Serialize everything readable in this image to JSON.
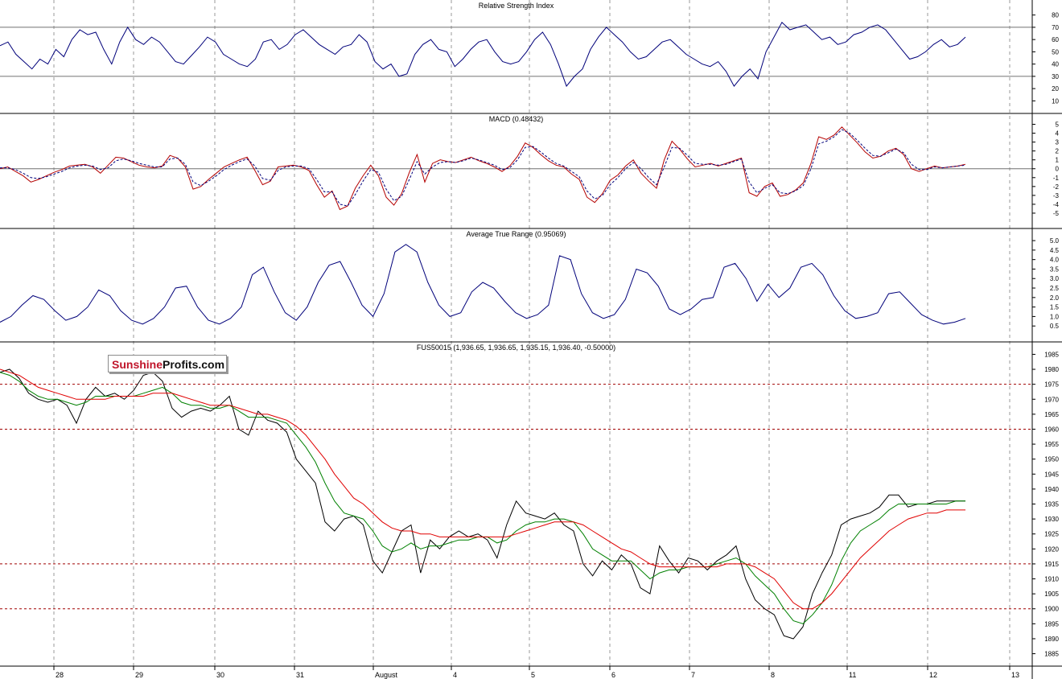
{
  "logo": {
    "part_a": "Sunshine",
    "part_b": "Profits.com"
  },
  "colors": {
    "background": "#ffffff",
    "grid": "#9a9a9a",
    "frame": "#000000",
    "rsi_line": "#00007a",
    "macd_line": "#b40000",
    "macd_signal": "#00007a",
    "atr_line": "#00007a",
    "price_line": "#000000",
    "ma_fast": "#008000",
    "ma_slow": "#e00000",
    "level_line": "#a00000"
  },
  "x_axis": {
    "labels": [
      "28",
      "29",
      "30",
      "31",
      "August",
      "4",
      "5",
      "6",
      "7",
      "8",
      "11",
      "12",
      "13"
    ]
  },
  "chart_data": [
    {
      "type": "line",
      "title": "Relative Strength Index",
      "ylim": [
        5,
        87
      ],
      "yticks": [
        "80",
        "70",
        "60",
        "50",
        "40",
        "30",
        "20",
        "10"
      ],
      "reference_lines": [
        70,
        30
      ],
      "grid": true,
      "series": [
        {
          "values": [
            55,
            58,
            48,
            42,
            36,
            44,
            40,
            52,
            46,
            60,
            68,
            64,
            66,
            52,
            40,
            58,
            70,
            60,
            56,
            62,
            58,
            50,
            42,
            40,
            47,
            54,
            62,
            58,
            48,
            44,
            40,
            38,
            44,
            58,
            60,
            52,
            56,
            64,
            68,
            62,
            56,
            52,
            48,
            54,
            56,
            64,
            58,
            42,
            36,
            40,
            30,
            32,
            48,
            56,
            60,
            52,
            50,
            38,
            44,
            52,
            58,
            60,
            50,
            42,
            40,
            42,
            50,
            60,
            66,
            56,
            40,
            22,
            30,
            36,
            52,
            62,
            70,
            64,
            58,
            50,
            44,
            46,
            52,
            58,
            60,
            54,
            48,
            44,
            40,
            38,
            42,
            34,
            22,
            30,
            36,
            28,
            50,
            62,
            74,
            68,
            70,
            72,
            66,
            60,
            62,
            56,
            58,
            64,
            66,
            70,
            72,
            68,
            60,
            52,
            44,
            46,
            50,
            56,
            60,
            54,
            56,
            62
          ]
        }
      ]
    },
    {
      "type": "line",
      "title": "MACD (0.48432)",
      "ylim": [
        -6,
        5.5
      ],
      "yticks": [
        "5",
        "4",
        "3",
        "2",
        "1",
        "0",
        "-1",
        "-2",
        "-3",
        "-4",
        "-5"
      ],
      "reference_lines": [
        0
      ],
      "grid": true,
      "series": [
        {
          "values": [
            0.0,
            0.2,
            -0.3,
            -0.8,
            -1.5,
            -1.2,
            -0.8,
            -0.4,
            -0.1,
            0.3,
            0.4,
            0.5,
            0.2,
            -0.5,
            0.4,
            1.3,
            1.2,
            0.8,
            0.4,
            0.2,
            0.1,
            0.3,
            1.5,
            1.2,
            0.2,
            -2.3,
            -2.0,
            -1.2,
            -0.5,
            0.2,
            0.6,
            1.0,
            1.3,
            -0.2,
            -1.8,
            -1.4,
            0.2,
            0.3,
            0.4,
            0.2,
            -0.2,
            -1.8,
            -3.2,
            -2.5,
            -4.6,
            -4.2,
            -2.2,
            -0.8,
            0.4,
            -0.8,
            -3.2,
            -4.1,
            -2.8,
            -0.4,
            1.6,
            -1.5,
            0.6,
            1.0,
            0.8,
            0.7,
            1.0,
            1.3,
            0.9,
            0.6,
            0.2,
            -0.3,
            0.3,
            1.4,
            2.9,
            2.4,
            1.6,
            0.9,
            0.4,
            0.2,
            -0.6,
            -1.2,
            -3.2,
            -3.8,
            -2.8,
            -1.3,
            -0.7,
            0.3,
            1.0,
            -0.5,
            -1.4,
            -2.2,
            1.0,
            3.1,
            2.2,
            1.1,
            0.2,
            0.4,
            0.6,
            0.3,
            0.6,
            0.9,
            1.2,
            -2.7,
            -3.1,
            -2.0,
            -1.6,
            -3.1,
            -2.9,
            -2.4,
            -1.6,
            0.6,
            3.6,
            3.3,
            3.8,
            4.7,
            3.8,
            2.9,
            1.9,
            1.2,
            1.4,
            2.0,
            2.3,
            1.6,
            0.0,
            -0.3,
            0.0,
            0.3,
            0.1,
            0.2,
            0.3,
            0.5
          ]
        },
        {
          "values": [
            0.1,
            0.1,
            -0.1,
            -0.5,
            -1.0,
            -1.1,
            -0.9,
            -0.6,
            -0.3,
            0.1,
            0.3,
            0.4,
            0.3,
            -0.1,
            0.1,
            0.9,
            1.1,
            0.9,
            0.6,
            0.4,
            0.2,
            0.2,
            1.1,
            1.2,
            0.5,
            -1.5,
            -1.9,
            -1.4,
            -0.8,
            -0.1,
            0.4,
            0.8,
            1.1,
            0.3,
            -1.1,
            -1.3,
            -0.2,
            0.2,
            0.3,
            0.3,
            0.0,
            -1.2,
            -2.6,
            -2.6,
            -4.0,
            -4.2,
            -2.9,
            -1.4,
            -0.1,
            -0.4,
            -2.3,
            -3.6,
            -3.1,
            -1.2,
            0.8,
            -0.6,
            0.2,
            0.7,
            0.8,
            0.7,
            0.9,
            1.2,
            1.0,
            0.7,
            0.4,
            -0.1,
            0.1,
            1.0,
            2.4,
            2.5,
            1.9,
            1.2,
            0.6,
            0.3,
            -0.3,
            -0.9,
            -2.5,
            -3.4,
            -3.0,
            -1.8,
            -1.0,
            0.0,
            0.7,
            0.0,
            -1.0,
            -1.8,
            0.2,
            2.4,
            2.3,
            1.5,
            0.6,
            0.5,
            0.5,
            0.4,
            0.5,
            0.8,
            1.1,
            -1.5,
            -2.7,
            -2.2,
            -1.8,
            -2.7,
            -2.8,
            -2.5,
            -1.9,
            0.0,
            2.8,
            3.1,
            3.6,
            4.4,
            4.0,
            3.2,
            2.3,
            1.5,
            1.4,
            1.8,
            2.2,
            1.8,
            0.5,
            -0.1,
            -0.1,
            0.2,
            0.1,
            0.2,
            0.3,
            0.4
          ]
        }
      ]
    },
    {
      "type": "line",
      "title": "Average True Range (0.95069)",
      "ylim": [
        0,
        5.3
      ],
      "yticks": [
        "5.0",
        "4.5",
        "4.0",
        "3.5",
        "3.0",
        "2.5",
        "2.0",
        "1.5",
        "1.0",
        "0.5"
      ],
      "grid": true,
      "series": [
        {
          "values": [
            0.7,
            1.0,
            1.6,
            2.1,
            1.9,
            1.3,
            0.8,
            1.0,
            1.5,
            2.4,
            2.1,
            1.3,
            0.8,
            0.6,
            0.9,
            1.5,
            2.5,
            2.6,
            1.5,
            0.8,
            0.6,
            0.9,
            1.5,
            3.2,
            3.6,
            2.3,
            1.2,
            0.8,
            1.5,
            2.8,
            3.7,
            3.9,
            2.8,
            1.6,
            1.0,
            2.2,
            4.4,
            4.8,
            4.4,
            2.8,
            1.6,
            1.0,
            1.2,
            2.3,
            2.8,
            2.5,
            1.8,
            1.2,
            0.9,
            1.1,
            1.6,
            4.2,
            4.0,
            2.2,
            1.2,
            0.9,
            1.1,
            1.9,
            3.5,
            3.3,
            2.6,
            1.4,
            1.1,
            1.4,
            1.9,
            2.0,
            3.6,
            3.8,
            3.0,
            1.8,
            2.7,
            2.0,
            2.5,
            3.6,
            3.8,
            3.2,
            2.1,
            1.3,
            0.9,
            1.0,
            1.2,
            2.2,
            2.3,
            1.7,
            1.1,
            0.8,
            0.6,
            0.7,
            0.9
          ]
        }
      ]
    },
    {
      "type": "line",
      "title": "FUS50015 (1,936.65, 1,936.65, 1,935.15, 1,936.40, -0.50000)",
      "ylim": [
        1883,
        1987
      ],
      "yticks": [
        "1985",
        "1980",
        "1975",
        "1970",
        "1965",
        "1960",
        "1955",
        "1950",
        "1945",
        "1940",
        "1935",
        "1930",
        "1925",
        "1920",
        "1915",
        "1910",
        "1905",
        "1900",
        "1895",
        "1890",
        "1885"
      ],
      "reference_lines": [
        1975,
        1960,
        1915,
        1900
      ],
      "grid": true,
      "series": [
        {
          "values": [
            1979,
            1980,
            1977,
            1972,
            1970,
            1969,
            1970,
            1968,
            1962,
            1970,
            1974,
            1971,
            1972,
            1970,
            1973,
            1978,
            1979,
            1976,
            1967,
            1964,
            1966,
            1967,
            1966,
            1968,
            1971,
            1960,
            1958,
            1966,
            1963,
            1962,
            1959,
            1950,
            1946,
            1942,
            1929,
            1926,
            1930,
            1931,
            1928,
            1916,
            1912,
            1919,
            1926,
            1928,
            1912,
            1923,
            1920,
            1924,
            1926,
            1924,
            1925,
            1923,
            1917,
            1928,
            1936,
            1932,
            1931,
            1930,
            1932,
            1928,
            1926,
            1915,
            1911,
            1916,
            1913,
            1918,
            1915,
            1907,
            1905,
            1921,
            1916,
            1912,
            1917,
            1916,
            1913,
            1916,
            1918,
            1921,
            1910,
            1903,
            1900,
            1898,
            1891,
            1890,
            1894,
            1905,
            1912,
            1918,
            1928,
            1930,
            1931,
            1932,
            1934,
            1938,
            1938,
            1934,
            1935,
            1935,
            1936,
            1936,
            1936,
            1936
          ]
        },
        {
          "values": [
            1979,
            1978,
            1976,
            1973,
            1971,
            1970,
            1970,
            1969,
            1968,
            1969,
            1971,
            1971,
            1971,
            1971,
            1971,
            1972,
            1973,
            1974,
            1972,
            1969,
            1968,
            1968,
            1967,
            1967,
            1968,
            1966,
            1964,
            1964,
            1964,
            1963,
            1962,
            1958,
            1954,
            1949,
            1942,
            1936,
            1932,
            1931,
            1930,
            1926,
            1921,
            1919,
            1920,
            1922,
            1920,
            1921,
            1921,
            1922,
            1923,
            1923,
            1924,
            1924,
            1922,
            1923,
            1926,
            1928,
            1929,
            1929,
            1930,
            1930,
            1929,
            1925,
            1920,
            1918,
            1916,
            1916,
            1916,
            1913,
            1910,
            1912,
            1913,
            1913,
            1914,
            1914,
            1914,
            1915,
            1916,
            1917,
            1915,
            1911,
            1908,
            1905,
            1900,
            1896,
            1895,
            1898,
            1902,
            1908,
            1916,
            1922,
            1926,
            1928,
            1930,
            1933,
            1935,
            1935,
            1935,
            1935,
            1935,
            1935,
            1936,
            1936
          ]
        },
        {
          "values": [
            1980,
            1979,
            1978,
            1976,
            1974,
            1973,
            1972,
            1971,
            1970,
            1970,
            1970,
            1970,
            1971,
            1971,
            1971,
            1971,
            1972,
            1972,
            1972,
            1971,
            1970,
            1969,
            1968,
            1968,
            1968,
            1967,
            1966,
            1965,
            1965,
            1964,
            1963,
            1961,
            1958,
            1954,
            1950,
            1945,
            1941,
            1937,
            1935,
            1932,
            1929,
            1927,
            1926,
            1926,
            1925,
            1925,
            1924,
            1924,
            1924,
            1924,
            1924,
            1924,
            1924,
            1924,
            1925,
            1926,
            1927,
            1928,
            1929,
            1929,
            1929,
            1928,
            1926,
            1924,
            1922,
            1920,
            1919,
            1917,
            1915,
            1914,
            1914,
            1914,
            1914,
            1914,
            1914,
            1914,
            1915,
            1915,
            1915,
            1914,
            1912,
            1910,
            1906,
            1902,
            1900,
            1900,
            1902,
            1905,
            1909,
            1913,
            1917,
            1920,
            1923,
            1926,
            1928,
            1930,
            1931,
            1932,
            1932,
            1933,
            1933,
            1933
          ]
        }
      ]
    }
  ]
}
